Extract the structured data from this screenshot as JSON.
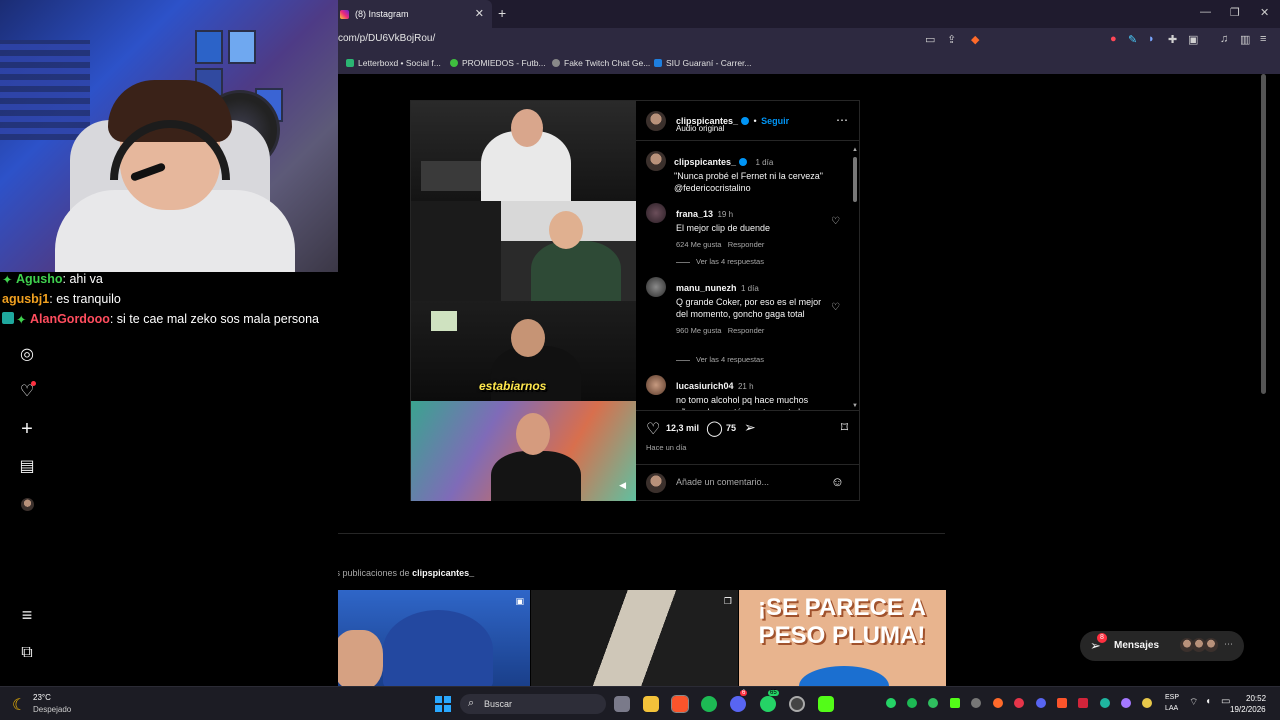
{
  "browser": {
    "tab_title": "(8) Instagram",
    "url": "com/p/DU6VkBojRou/",
    "bookmarks": [
      "Letterboxd • Social f...",
      "PROMIEDOS - Futb...",
      "Fake Twitch Chat Ge...",
      "SIU Guaraní - Carrer..."
    ]
  },
  "stream_chat": [
    {
      "user": "Agusho",
      "message": ": ahi va",
      "color": "#3fd14e"
    },
    {
      "user": "agusbj1",
      "message": ": es tranquilo",
      "color": "#f0a020"
    },
    {
      "user": "AlanGordooo",
      "message": ": si te cae mal zeko sos mala persona",
      "color": "#ff4d5e"
    }
  ],
  "post": {
    "author": "clipspicantes_",
    "follow_label": "Seguir",
    "separator": "•",
    "audio": "Audio original",
    "video_overlay_text": "estabiarnos",
    "caption": {
      "user": "clipspicantes_",
      "time": "1 día",
      "text": "\"Nunca probé el Fernet ni la cerveza\"",
      "mention": "@federicocristalino"
    },
    "comments": [
      {
        "user": "frana_13",
        "time": "19 h",
        "text": "El mejor clip de duende",
        "likes": "624 Me gusta",
        "reply_label": "Responder",
        "view_replies": "Ver las 4 respuestas"
      },
      {
        "user": "manu_nunezh",
        "time": "1 día",
        "text": "Q grande Coker, por eso es el mejor del momento, goncho gaga total",
        "likes": "960 Me gusta",
        "reply_label": "Responder",
        "view_replies": "Ver las 4 respuestas"
      },
      {
        "user": "lucasiurich04",
        "time": "21 h",
        "text": "no tomo alcohol pq hace muchos años zeko contó exactamente lo"
      }
    ],
    "likes_count": "12,3 mil",
    "comments_count": "75",
    "posted": "Hace un día",
    "comment_placeholder": "Añade un comentario..."
  },
  "more_posts": {
    "prefix": "Más publicaciones de ",
    "author": "clipspicantes_",
    "third_thumb_text": "¡SE PARECE A PESO PLUMA!"
  },
  "messages": {
    "label": "Mensajes",
    "badge": "8"
  },
  "taskbar": {
    "weather_temp": "23°C",
    "weather_desc": "Despejado",
    "search_placeholder": "Buscar",
    "lang_top": "ESP",
    "lang_bottom": "LAA",
    "time": "20:52",
    "date": "19/2/2026",
    "discord_badge": "6",
    "whatsapp_badge": "65"
  }
}
